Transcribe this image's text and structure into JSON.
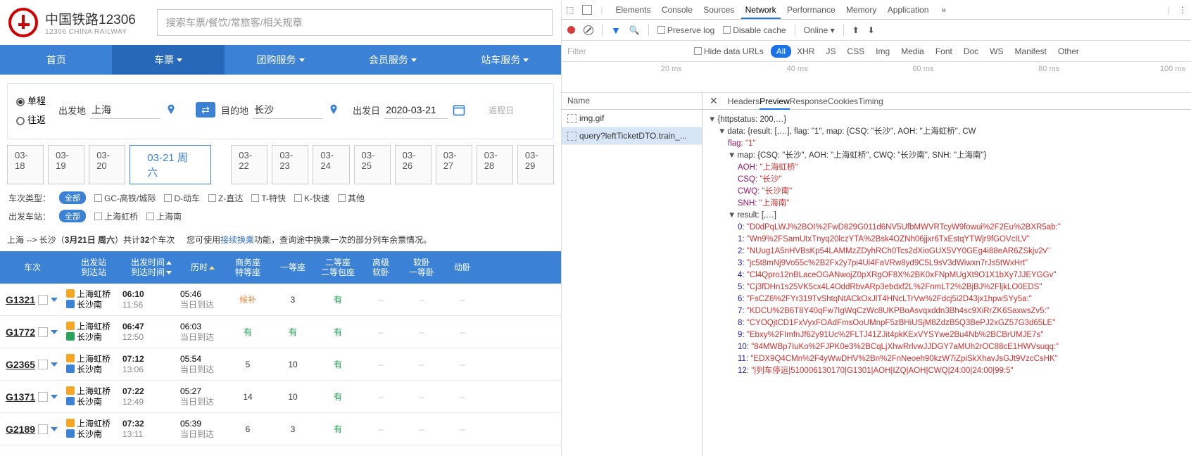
{
  "brand": {
    "cn": "中国铁路12306",
    "en": "12306 CHINA RAILWAY"
  },
  "searchPlaceholder": "搜索车票/餐饮/常旅客/相关规章",
  "nav": {
    "home": "首页",
    "ticket": "车票",
    "group": "团购服务",
    "member": "会员服务",
    "station": "站车服务"
  },
  "trip": {
    "single": "单程",
    "round": "往返"
  },
  "form": {
    "fromLbl": "出发地",
    "from": "上海",
    "toLbl": "目的地",
    "to": "长沙",
    "dateLbl": "出发日",
    "date": "2020-03-21",
    "return": "返程日"
  },
  "dates": [
    "03-18",
    "03-19",
    "03-20",
    "03-21 周六",
    "03-22",
    "03-23",
    "03-24",
    "03-25",
    "03-26",
    "03-27",
    "03-28",
    "03-29"
  ],
  "typeRow": {
    "lbl": "车次类型：",
    "all": "全部",
    "items": [
      "GC-高铁/城际",
      "D-动车",
      "Z-直达",
      "T-特快",
      "K-快速",
      "其他"
    ]
  },
  "stationRow": {
    "lbl": "出发车站：",
    "all": "全部",
    "items": [
      "上海虹桥",
      "上海南"
    ]
  },
  "summary": {
    "route": "上海 --> 长沙（",
    "d": "3月21日 周六",
    "rest": "）共计",
    "cnt": "32",
    "unit": "个车次",
    "hint": "您可使用",
    "link": "接续换乘",
    "tail": "功能，查询途中换乘一次的部分列车余票情况。"
  },
  "th": {
    "c1": "车次",
    "c2a": "出发站",
    "c2b": "到达站",
    "c3a": "出发时间",
    "c3b": "到达时间",
    "c4": "历时",
    "c5a": "商务座",
    "c5b": "特等座",
    "c6": "一等座",
    "c7a": "二等座",
    "c7b": "二等包座",
    "c8a": "高级",
    "c8b": "软卧",
    "c9a": "软卧",
    "c9b": "一等卧",
    "c10": "动卧"
  },
  "rows": [
    {
      "no": "G1321",
      "from": "上海虹桥",
      "to": "长沙南",
      "dep": "06:10",
      "arr": "11:56",
      "dur": "05:46",
      "same": "当日到达",
      "biz": "候补",
      "first": "3",
      "second": "有",
      "hsleep": "--",
      "sleep": "--",
      "dsleep": "--",
      "bizCls": "o"
    },
    {
      "no": "G1772",
      "from": "上海虹桥",
      "to": "长沙南",
      "dep": "06:47",
      "arr": "12:50",
      "dur": "06:03",
      "same": "当日到达",
      "biz": "有",
      "first": "有",
      "second": "有",
      "hsleep": "--",
      "sleep": "--",
      "dsleep": "--",
      "bizCls": "g",
      "toIc": "g"
    },
    {
      "no": "G2365",
      "from": "上海虹桥",
      "to": "长沙南",
      "dep": "07:12",
      "arr": "13:06",
      "dur": "05:54",
      "same": "当日到达",
      "biz": "5",
      "first": "10",
      "second": "有",
      "hsleep": "--",
      "sleep": "--",
      "dsleep": "--"
    },
    {
      "no": "G1371",
      "from": "上海虹桥",
      "to": "长沙南",
      "dep": "07:22",
      "arr": "12:49",
      "dur": "05:27",
      "same": "当日到达",
      "biz": "14",
      "first": "10",
      "second": "有",
      "hsleep": "--",
      "sleep": "--",
      "dsleep": "--"
    },
    {
      "no": "G2189",
      "from": "上海虹桥",
      "to": "长沙南",
      "dep": "07:32",
      "arr": "13:11",
      "dur": "05:39",
      "same": "当日到达",
      "biz": "6",
      "first": "3",
      "second": "有",
      "hsleep": "--",
      "sleep": "--",
      "dsleep": "--"
    }
  ],
  "dt": {
    "tabs": [
      "Elements",
      "Console",
      "Sources",
      "Network",
      "Performance",
      "Memory",
      "Application"
    ],
    "more": "»",
    "row2": {
      "preserve": "Preserve log",
      "disable": "Disable cache",
      "online": "Online"
    },
    "row3": {
      "filter": "Filter",
      "hide": "Hide data URLs",
      "types": [
        "All",
        "XHR",
        "JS",
        "CSS",
        "Img",
        "Media",
        "Font",
        "Doc",
        "WS",
        "Manifest",
        "Other"
      ]
    },
    "ticks": [
      "20 ms",
      "40 ms",
      "60 ms",
      "80 ms",
      "100 ms"
    ],
    "reqHeader": "Name",
    "reqs": [
      "img.gif",
      "query?leftTicketDTO.train_..."
    ],
    "detTabs": [
      "Headers",
      "Preview",
      "Response",
      "Cookies",
      "Timing"
    ],
    "json": {
      "status": "{httpstatus: 200,…}",
      "dataLine": "data: {result: [,…], flag: \"1\", map: {CSQ: \"长沙\", AOH: \"上海虹桥\", CW",
      "flag": "flag: ",
      "flagV": "\"1\"",
      "mapLine": "map: {CSQ: \"长沙\", AOH: \"上海虹桥\", CWQ: \"长沙南\", SNH: \"上海南\"}",
      "mapItems": [
        [
          "AOH",
          "\"上海虹桥\""
        ],
        [
          "CSQ",
          "\"长沙\""
        ],
        [
          "CWQ",
          "\"长沙南\""
        ],
        [
          "SNH",
          "\"上海南\""
        ]
      ],
      "resLine": "result: [,…]",
      "results": [
        "\"D0dPqLWJ%2BOI%2FwD829G011d6NV5UfbMWVRTcyW9fowui%2F2Eu%2BXR5ab:\"",
        "\"Wn9%2FSamUtxTnyq20lczYTA%2Bsk4OZNh06jjxr6TxEstqYTWjr9fGOVcILV\"",
        "\"NUug1A5nHVBsKp54LAMMzZDyhRCh0Tcs2dXioGUX5VY0GEg4i88eAR6ZSkjv2v\"",
        "\"jc5t8mNj9Vo55c%2B2Fx2y7pi4Ui4FaVRw8yd9C5L9sV3dWiwxn7rJs5tWxHrt\"",
        "\"Cl4Qpro12nBLaceOGANwojZ0pXRgOF8X%2BK0xFNpMUgXt9O1X1bXy7JJEYGGv\"",
        "\"Cj3fDHn1s25VK5cx4L4OddRbvARp3ebdxf2L%2FnmLT2%2BjBJ%2FljkLO0EDS\"",
        "\"FsCZ6%2FYr319TvShtqNtACkOxJlT4HNcLTrVw%2Fdcj5i2D43jx1hpwSYy5a:\"",
        "\"KDCU%2B6T8Y40qFw7IgWqCzWc8UKPBoAsvqxddn3Bh4sc9XiRrZK6SaxwsZv5:\"",
        "\"CYOQjtCD1FxVyxFOAdFmsOoUMnpF5zBHiUSjM8ZdzB5Q3BePJ2xGZ57G3d65LE\"",
        "\"Ebxy%2FImfnJf62y91Uc%2FLTJ41ZJit4pkKExVYSYwe2Bu4Nb%2BCBrUMJE7s\"",
        "\"84MWBp7IuKo%2FJPK0e3%2BCqLjXhwRrlvwJJDGY7aMUh2rOC88cE1HWVsuqq:\"",
        "\"EDX9Q4CMn%2F4yWwDHV%2Bn%2FnNeoeh90kzW7iZpiSkXhavJsGJt9VzcCsHK\"",
        "\"|列车停运|510006130170|G1301|AOH|IZQ|AOH|CWQ|24:00|24:00|99:5\""
      ]
    }
  }
}
